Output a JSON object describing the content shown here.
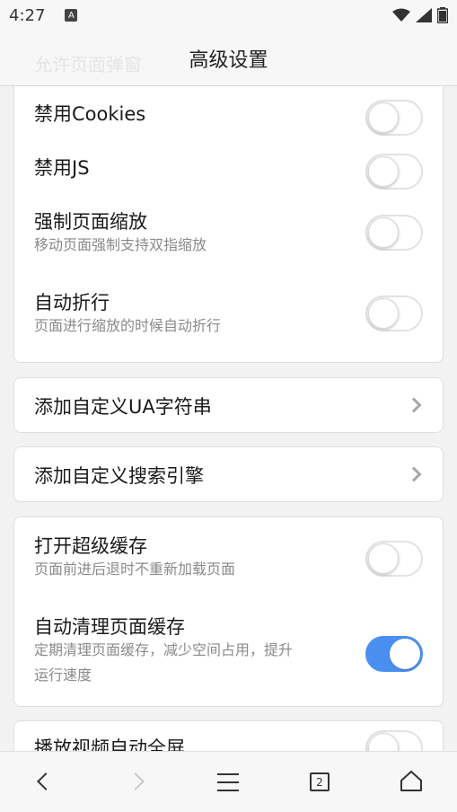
{
  "status_bar": {
    "time": "4:27",
    "notification_badge": "A"
  },
  "header": {
    "title": "高级设置",
    "ghost_text": "允许页面弹窗"
  },
  "cards": [
    {
      "rows": [
        {
          "title": "禁用Cookies",
          "enabled": false
        },
        {
          "title": "禁用JS",
          "enabled": false
        },
        {
          "title": "强制页面缩放",
          "subtitle": "移动页面强制支持双指缩放",
          "enabled": false
        },
        {
          "title": "自动折行",
          "subtitle": "页面进行缩放的时候自动折行",
          "enabled": false
        }
      ]
    },
    {
      "link": {
        "title": "添加自定义UA字符串"
      }
    },
    {
      "link": {
        "title": "添加自定义搜索引擎"
      }
    },
    {
      "rows": [
        {
          "title": "打开超级缓存",
          "subtitle": "页面前进后退时不重新加载页面",
          "enabled": false
        },
        {
          "title": "自动清理页面缓存",
          "subtitle_line1": "定期清理页面缓存，减少空间占用，提升",
          "subtitle_line2": "运行速度",
          "enabled": true
        }
      ]
    },
    {
      "rows": [
        {
          "title": "播放视频自动全屏",
          "enabled": false
        }
      ]
    }
  ],
  "nav_bar": {
    "tab_count": "2"
  },
  "colors": {
    "accent": "#4a8ff0",
    "background": "#f2f2f2",
    "card": "#ffffff"
  }
}
